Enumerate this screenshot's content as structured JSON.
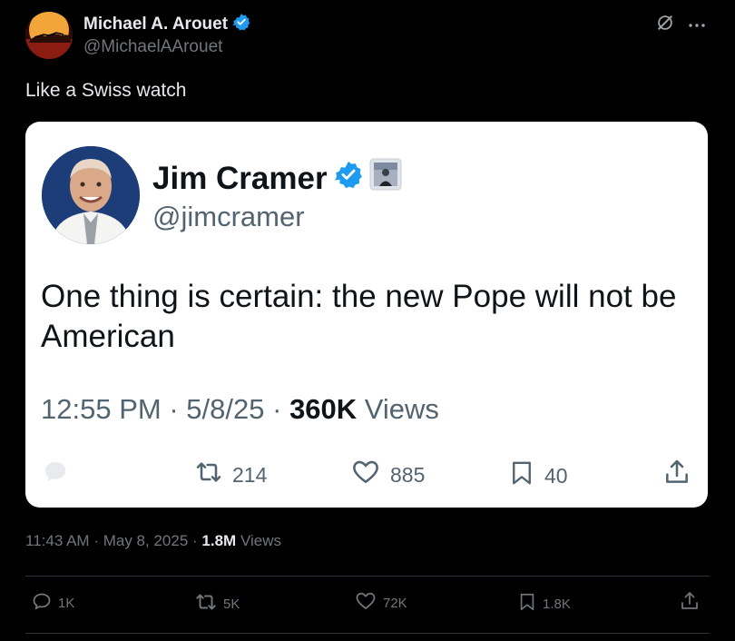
{
  "author": {
    "name": "Michael A. Arouet",
    "handle": "@MichaelAArouet",
    "verified": true,
    "avatar": "avatar"
  },
  "tweet": {
    "text": "Like a Swiss watch"
  },
  "quoted": {
    "name": "Jim Cramer",
    "handle": "@jimcramer",
    "verified": true,
    "text": "One thing is certain: the new Pope will not be American",
    "time": "12:55 PM",
    "date": "5/8/25",
    "views_count": "360K",
    "views_label": "Views",
    "sep": "·",
    "actions": {
      "replies": "",
      "retweets": "214",
      "likes": "885",
      "bookmarks": "40"
    }
  },
  "meta": {
    "time": "11:43 AM",
    "date": "May 8, 2025",
    "views_count": "1.8M",
    "views_label": "Views",
    "sep": "·"
  },
  "actions": {
    "replies": "1K",
    "retweets": "5K",
    "likes": "72K",
    "bookmarks": "1.8K"
  },
  "colors": {
    "verified": "#1d9bf0",
    "background": "#000000",
    "card": "#ffffff"
  }
}
